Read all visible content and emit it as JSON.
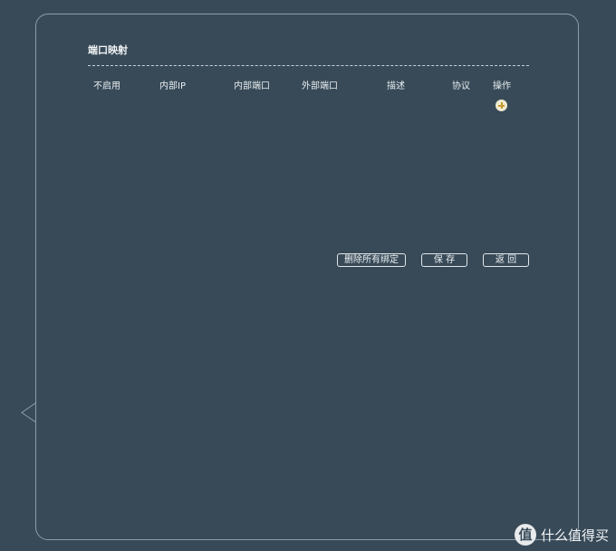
{
  "section": {
    "title": "端口映射"
  },
  "table": {
    "columns": [
      "不启用",
      "内部IP",
      "内部端口",
      "外部端口",
      "描述",
      "协议",
      "操作"
    ],
    "rows": []
  },
  "actions": {
    "add_label": "+",
    "delete_all_label": "删除所有绑定",
    "save_label": "保 存",
    "back_label": "返 回"
  },
  "watermark": {
    "logo": "值",
    "text": "什么值得买"
  },
  "colors": {
    "background": "#384a58",
    "border": "#8d9ca8",
    "text": "#e6ebef",
    "add_icon_fill": "#f0ead0",
    "add_icon_plus": "#c59a2c"
  }
}
